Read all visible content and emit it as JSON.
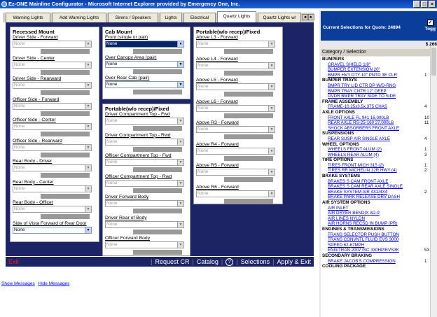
{
  "window": {
    "title": "Ez-ONE Mainline Configurator - Microsoft Internet Explorer provided by Emergency One, Inc.",
    "buttons": [
      "_",
      "□",
      "×"
    ]
  },
  "tabs": [
    "Warning Lights",
    "Add Warning Lights",
    "Sirens / Speakers",
    "Lights",
    "Electrical",
    "Quartz Lights",
    "Quartz Lights w/"
  ],
  "tab_scroll": [
    "◄",
    "►"
  ],
  "panels": {
    "recessed": {
      "title": "Recessed Mount",
      "fields": [
        {
          "label": "Driver Side - Forward",
          "value": "None"
        },
        {
          "label": "Driver Side - Center",
          "value": "None"
        },
        {
          "label": "Driver Side - Rearward",
          "value": "None"
        },
        {
          "label": "Officer Side - Forward",
          "value": "None"
        },
        {
          "label": "Officer Side - Center",
          "value": "None"
        },
        {
          "label": "Officer Side - Rearward",
          "value": "None"
        },
        {
          "label": "Rear Body - Driver",
          "value": "None"
        },
        {
          "label": "Rear Body - Center",
          "value": "None"
        },
        {
          "label": "Rear Body - Officer",
          "value": "None"
        },
        {
          "label": "Side of Vista Forward of Rear Door",
          "value": "None"
        }
      ]
    },
    "cab": {
      "title": "Cab Mount",
      "fields": [
        {
          "label": "Front (single or pair)",
          "value": "None"
        },
        {
          "label": "Over Canopy Area (pair)",
          "value": "None"
        },
        {
          "label": "Over Rear Cab (pair)",
          "value": "None"
        }
      ]
    },
    "portable_left": {
      "title": "Portable(w/o recep)/Fixed",
      "fields": [
        {
          "label": "Driver Compartment Top - Fwd",
          "value": "None"
        },
        {
          "label": "Driver Compartment Top - Rwd",
          "value": "None"
        },
        {
          "label": "Officer Compartment Top - Fwd",
          "value": "None"
        },
        {
          "label": "Officer Compartment Top - Rwd",
          "value": "None"
        },
        {
          "label": "Driver Forward Body",
          "value": "None"
        },
        {
          "label": "Driver Rear of Body",
          "value": "None"
        },
        {
          "label": "Officer Forward Body",
          "value": "None"
        }
      ]
    },
    "portable_right": {
      "title": "Portable(w/o recep)/Fixed",
      "fields": [
        {
          "label": "Above L3 - Forward",
          "value": "None"
        },
        {
          "label": "Above L4 - Forward",
          "value": "None"
        },
        {
          "label": "Above L5 - Forward",
          "value": "None"
        },
        {
          "label": "Above L6 - Forward",
          "value": "None"
        },
        {
          "label": "Above R3 - Forward",
          "value": "None"
        },
        {
          "label": "Above R4 - Forward",
          "value": "None"
        },
        {
          "label": "Above R5 - Forward",
          "value": "None"
        },
        {
          "label": "Above R6 - Forward",
          "value": "None"
        }
      ]
    }
  },
  "bottombar": {
    "exit": "Exit",
    "request_cr": "Request CR",
    "catalog": "Catalog",
    "help": "?",
    "selections": "Selections",
    "apply_exit": "Apply & Exit",
    "sep": "|"
  },
  "messages": {
    "show": "Show Messages",
    "hide": "Hide Messages"
  },
  "sidebar": {
    "header": "Current Selections for Quote: 24894",
    "toggle": "Togg",
    "checkbox": "✓",
    "total": "$ 266",
    "cat_header": "Category / Selection",
    "entries": [
      {
        "k": "c",
        "t": "BUMPERS"
      },
      {
        "k": "i",
        "t": "GRAVEL SHIELD 1/8\"",
        "q": ""
      },
      {
        "k": "i",
        "t": "BUMPER EXTENSION 20\"",
        "q": ""
      },
      {
        "k": "i",
        "t": "BMPR HVY DTY 10\" PNTD 3E CLR",
        "q": "1"
      },
      {
        "k": "c",
        "t": "BUMPER TRAYS"
      },
      {
        "k": "i",
        "t": "BMPR TRY LID CTR DP W/D-RNG",
        "q": ""
      },
      {
        "k": "i",
        "t": "BMPR TRAY CNTR 12\" DEEP",
        "q": ""
      },
      {
        "k": "i",
        "t": "DVDR BMPR TRAY SIDE TO SIDE",
        "q": ""
      },
      {
        "k": "c",
        "t": "FRAME ASSEMBLY"
      },
      {
        "k": "i",
        "t": "FRAME-10.25x3.5x.375 CHAS",
        "q": "4"
      },
      {
        "k": "c",
        "t": "AXLE OPTIONS"
      },
      {
        "k": "i",
        "t": "FRONT AXLE FL 941 16,000LB",
        "q": "10"
      },
      {
        "k": "i",
        "t": "REAR AXLE RS-25-160 27,000LB",
        "q": "11"
      },
      {
        "k": "i",
        "t": "SHOCK ABSORBERS FRONT AXLE",
        "q": ""
      },
      {
        "k": "c",
        "t": "SUSPENSIONS"
      },
      {
        "k": "i",
        "t": "REAR SUSP AIR SINGLE AXLE",
        "q": "4"
      },
      {
        "k": "c",
        "t": "WHEEL OPTIONS"
      },
      {
        "k": "i",
        "t": "WHEELS FRONT ALUM (2)",
        "q": "1"
      },
      {
        "k": "i",
        "t": "WHEELS REAR ALUM (4)",
        "q": "3"
      },
      {
        "k": "c",
        "t": "TIRE OPTIONS"
      },
      {
        "k": "i",
        "t": "TIRES FRONT MICH 315 (2)",
        "q": "1"
      },
      {
        "k": "i",
        "t": "TIRES RR MICHELIN 12R HWY (4)",
        "q": "2"
      },
      {
        "k": "c",
        "t": "BRAKE SYSTEMS"
      },
      {
        "k": "i",
        "t": "BRAKES S CAM FRONT AXLE",
        "q": ""
      },
      {
        "k": "i",
        "t": "BRAKES S CAM REAR AXLE SINGLE",
        "q": ""
      },
      {
        "k": "i",
        "t": "BRAKE SYSTEM AIR 4X2/4X4",
        "q": "2"
      },
      {
        "k": "i",
        "t": "BRAKE PARK RELEASE DRV DASH",
        "q": ""
      },
      {
        "k": "c",
        "t": "AIR SYSTEM OPTIONS"
      },
      {
        "k": "i",
        "t": "AIR INLET",
        "q": ""
      },
      {
        "k": "i",
        "t": "AIR DRYER BENDIX AD-9",
        "q": ""
      },
      {
        "k": "i",
        "t": "AIR LINES NYLON",
        "q": ""
      },
      {
        "k": "i",
        "t": "AIR HORNS RECSD IN BUMP (PR)",
        "q": ""
      },
      {
        "k": "c",
        "t": "ENGINES & TRANSMISSIONS"
      },
      {
        "k": "i",
        "t": "TRANS SELECTOR PUSH BUTTON",
        "q": ""
      },
      {
        "k": "i",
        "t": "TRANS CONVNTL FLUID EVS 3000",
        "q": ""
      },
      {
        "k": "i",
        "t": "SPEED 62-67MPH",
        "q": ""
      },
      {
        "k": "i",
        "t": "ENG/TRAN 2007 ISC 330HP/EVS3K",
        "q": "53"
      },
      {
        "k": "c",
        "t": "SECONDARY BRAKING"
      },
      {
        "k": "i",
        "t": "BRAKE JACOB'S COMPRESSION",
        "q": "1"
      },
      {
        "k": "c",
        "t": "COOLING PACKAGE"
      }
    ]
  }
}
